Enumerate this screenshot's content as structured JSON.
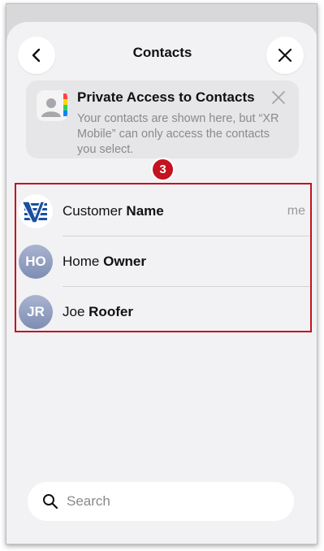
{
  "header": {
    "title": "Contacts",
    "back_icon": "chevron-left-icon",
    "close_icon": "close-icon"
  },
  "banner": {
    "title": "Private Access to Contacts",
    "text": "Your contacts are shown here, but “XR Mobile” can only access the contacts you select.",
    "icon": "contacts-app-icon",
    "dismiss_icon": "close-icon"
  },
  "annotation": {
    "step": "3",
    "color": "#c4121f"
  },
  "contacts": [
    {
      "first": "Customer",
      "last": "Name",
      "initials": "",
      "tag": "me",
      "avatar": "company-logo-icon"
    },
    {
      "first": "Home",
      "last": "Owner",
      "initials": "HO",
      "tag": ""
    },
    {
      "first": "Joe",
      "last": "Roofer",
      "initials": "JR",
      "tag": ""
    }
  ],
  "search": {
    "placeholder": "Search",
    "value": ""
  }
}
